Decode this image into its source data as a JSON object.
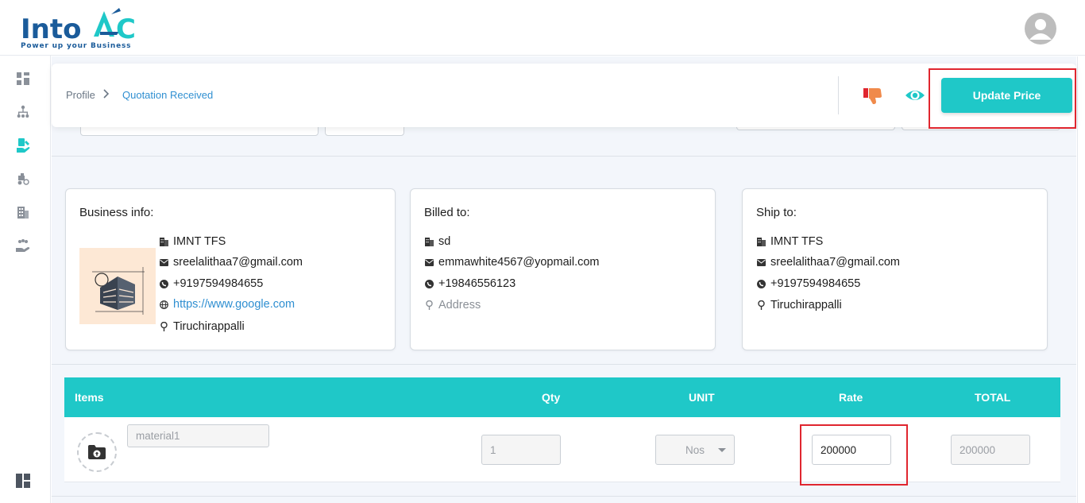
{
  "brand": {
    "logo_text": "IntoAEC",
    "tagline": "Power up your Business",
    "colors": {
      "primary": "#1a5b9a",
      "accent": "#1fc8c8",
      "link": "#2f8fd1",
      "highlight": "#e0262f"
    }
  },
  "sidebar": {
    "items": [
      {
        "name": "dashboard",
        "icon": "dashboard-grid-icon"
      },
      {
        "name": "hierarchy",
        "icon": "org-chart-icon"
      },
      {
        "name": "quotations",
        "icon": "hand-document-icon",
        "active": true
      },
      {
        "name": "vehicles",
        "icon": "vehicle-icon"
      },
      {
        "name": "buildings",
        "icon": "building-icon"
      },
      {
        "name": "users",
        "icon": "group-hand-icon"
      }
    ],
    "bottom_icon": "layout-panel-icon"
  },
  "breadcrumb": {
    "profile": "Profile",
    "separator": ">",
    "current": "Quotation Received"
  },
  "actions": {
    "dislike_icon": "thumbs-down-icon",
    "view_icon": "eye-icon",
    "update_label": "Update Price"
  },
  "business_info": {
    "title": "Business info:",
    "name": "IMNT TFS",
    "email": "sreelalithaa7@gmail.com",
    "phone": "+9197594984655",
    "website": "https://www.google.com",
    "location": "Tiruchirappalli"
  },
  "billed_to": {
    "title": "Billed to:",
    "name": "sd",
    "email": "emmawhite4567@yopmail.com",
    "phone": "+19846556123",
    "address": "Address"
  },
  "ship_to": {
    "title": "Ship to:",
    "name": "IMNT TFS",
    "email": "sreelalithaa7@gmail.com",
    "phone": "+9197594984655",
    "location": "Tiruchirappalli"
  },
  "items_table": {
    "headers": {
      "items": "Items",
      "qty": "Qty",
      "unit": "UNIT",
      "rate": "Rate",
      "total": "TOTAL"
    },
    "rows": [
      {
        "material": "material1",
        "qty": "1",
        "unit": "Nos",
        "rate": "200000",
        "total": "200000"
      }
    ]
  }
}
